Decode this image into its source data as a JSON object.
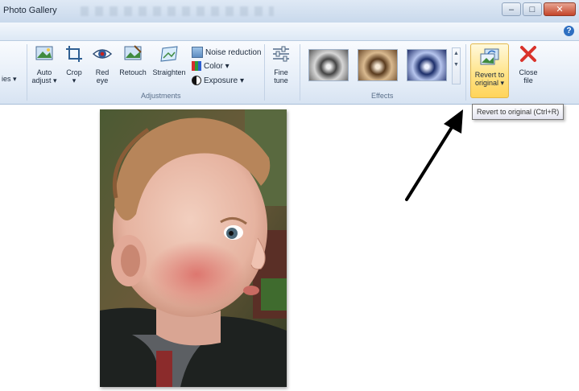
{
  "window": {
    "title": "Photo Gallery",
    "minimize_glyph": "–",
    "maximize_glyph": "□",
    "close_glyph": "✕",
    "help_glyph": "?"
  },
  "ribbon": {
    "partial_label": "ies ▾",
    "adjustments": {
      "group_label": "Adjustments",
      "auto_adjust": [
        "Auto",
        "adjust ▾"
      ],
      "crop": [
        "Crop",
        "▾"
      ],
      "red_eye": [
        "Red",
        "eye"
      ],
      "retouch": "Retouch",
      "straighten": "Straighten",
      "noise_reduction": "Noise reduction",
      "color": "Color ▾",
      "exposure": "Exposure ▾",
      "fine_tune": [
        "Fine",
        "tune"
      ]
    },
    "effects": {
      "group_label": "Effects",
      "items": [
        "black-and-white-effect",
        "sepia-effect",
        "cyan-effect"
      ]
    },
    "revert": [
      "Revert to",
      "original ▾"
    ],
    "close_file": [
      "Close",
      "file"
    ]
  },
  "tooltip": {
    "text": "Revert to original (Ctrl+R)"
  },
  "colors": {
    "ribbon_top": "#f9fbfe",
    "ribbon_bottom": "#d7e3f2",
    "revert_highlight": "#ffe48a",
    "close_red": "#d9332b"
  },
  "icons": {
    "auto_adjust": "auto-adjust-icon",
    "crop": "crop-icon",
    "red_eye": "red-eye-icon",
    "retouch": "retouch-icon",
    "straighten": "straighten-icon",
    "noise": "noise-reduction-icon",
    "color": "color-icon",
    "exposure": "exposure-icon",
    "fine_tune": "fine-tune-icon",
    "revert": "revert-icon",
    "close": "close-file-icon"
  }
}
